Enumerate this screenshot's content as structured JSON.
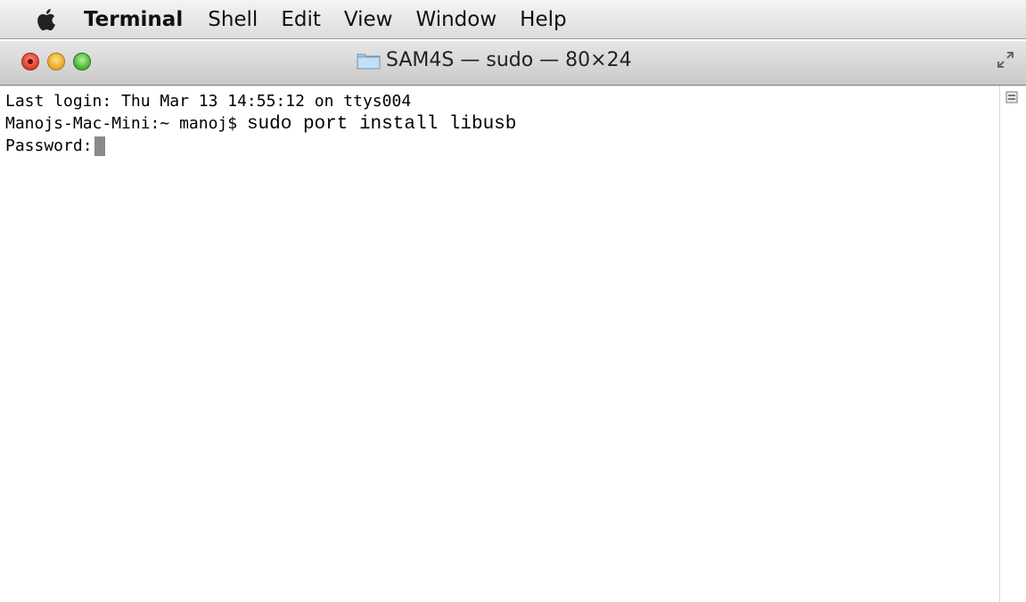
{
  "menubar": {
    "apple_icon": "apple-icon",
    "items": [
      "Terminal",
      "Shell",
      "Edit",
      "View",
      "Window",
      "Help"
    ]
  },
  "window": {
    "title": "SAM4S — sudo — 80×24",
    "folder_icon": "folder-icon",
    "fullscreen_icon": "fullscreen-icon"
  },
  "terminal": {
    "line1": "Last login: Thu Mar 13 14:55:12 on ttys004",
    "prompt": "Manojs-Mac-Mini:~ manoj$ ",
    "command": "sudo port install libusb",
    "password_prompt": "Password:"
  },
  "colors": {
    "close": "#d83a2c",
    "minimize": "#e8a420",
    "zoom": "#3fb02c",
    "cursor": "#8a8a8a"
  }
}
